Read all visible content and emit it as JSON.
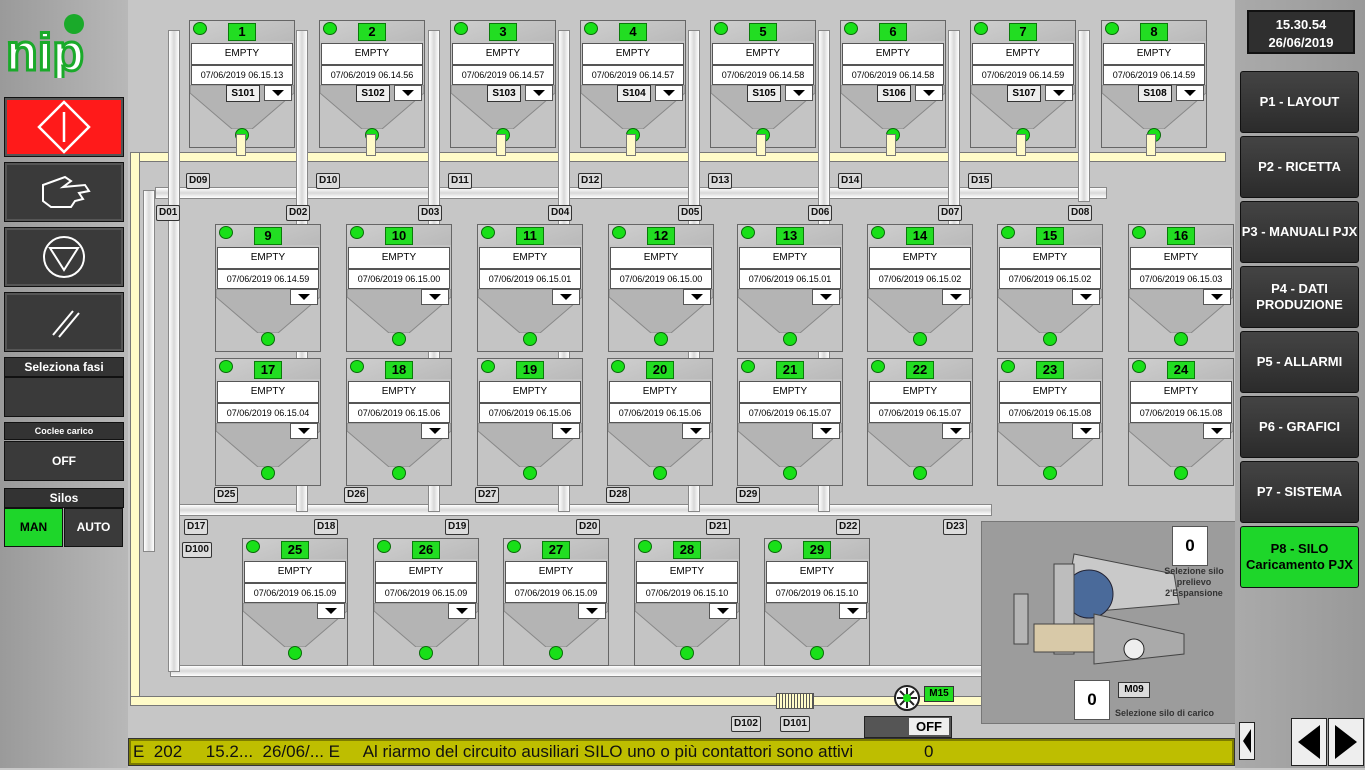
{
  "header": {
    "logo_text": "nip"
  },
  "clock": {
    "time": "15.30.54",
    "date": "26/06/2019"
  },
  "left": {
    "seleziona_fasi_label": "Seleziona fasi",
    "coclee_label": "Coclee carico",
    "coclee_value": "OFF",
    "silos_label": "Silos",
    "man_label": "MAN",
    "auto_label": "AUTO"
  },
  "nav": [
    {
      "label": "P1 - LAYOUT"
    },
    {
      "label": "P2 - RICETTA"
    },
    {
      "label": "P3 - MANUALI PJX"
    },
    {
      "label": "P4 - DATI PRODUZIONE"
    },
    {
      "label": "P5 - ALLARMI"
    },
    {
      "label": "P6 - GRAFICI"
    },
    {
      "label": "P7 - SISTEMA"
    },
    {
      "label": "P8 - SILO Caricamento PJX"
    }
  ],
  "silos": [
    {
      "num": "1",
      "state": "EMPTY",
      "date": "07/06/2019 06.15.13",
      "sid": "S101"
    },
    {
      "num": "2",
      "state": "EMPTY",
      "date": "07/06/2019 06.14.56",
      "sid": "S102"
    },
    {
      "num": "3",
      "state": "EMPTY",
      "date": "07/06/2019 06.14.57",
      "sid": "S103"
    },
    {
      "num": "4",
      "state": "EMPTY",
      "date": "07/06/2019 06.14.57",
      "sid": "S104"
    },
    {
      "num": "5",
      "state": "EMPTY",
      "date": "07/06/2019 06.14.58",
      "sid": "S105"
    },
    {
      "num": "6",
      "state": "EMPTY",
      "date": "07/06/2019 06.14.58",
      "sid": "S106"
    },
    {
      "num": "7",
      "state": "EMPTY",
      "date": "07/06/2019 06.14.59",
      "sid": "S107"
    },
    {
      "num": "8",
      "state": "EMPTY",
      "date": "07/06/2019 06.14.59",
      "sid": "S108"
    },
    {
      "num": "9",
      "state": "EMPTY",
      "date": "07/06/2019 06.14.59"
    },
    {
      "num": "10",
      "state": "EMPTY",
      "date": "07/06/2019 06.15.00"
    },
    {
      "num": "11",
      "state": "EMPTY",
      "date": "07/06/2019 06.15.01"
    },
    {
      "num": "12",
      "state": "EMPTY",
      "date": "07/06/2019 06.15.00"
    },
    {
      "num": "13",
      "state": "EMPTY",
      "date": "07/06/2019 06.15.01"
    },
    {
      "num": "14",
      "state": "EMPTY",
      "date": "07/06/2019 06.15.02"
    },
    {
      "num": "15",
      "state": "EMPTY",
      "date": "07/06/2019 06.15.02"
    },
    {
      "num": "16",
      "state": "EMPTY",
      "date": "07/06/2019 06.15.03"
    },
    {
      "num": "17",
      "state": "EMPTY",
      "date": "07/06/2019 06.15.04"
    },
    {
      "num": "18",
      "state": "EMPTY",
      "date": "07/06/2019 06.15.06"
    },
    {
      "num": "19",
      "state": "EMPTY",
      "date": "07/06/2019 06.15.06"
    },
    {
      "num": "20",
      "state": "EMPTY",
      "date": "07/06/2019 06.15.06"
    },
    {
      "num": "21",
      "state": "EMPTY",
      "date": "07/06/2019 06.15.07"
    },
    {
      "num": "22",
      "state": "EMPTY",
      "date": "07/06/2019 06.15.07"
    },
    {
      "num": "23",
      "state": "EMPTY",
      "date": "07/06/2019 06.15.08"
    },
    {
      "num": "24",
      "state": "EMPTY",
      "date": "07/06/2019 06.15.08"
    },
    {
      "num": "25",
      "state": "EMPTY",
      "date": "07/06/2019 06.15.09"
    },
    {
      "num": "26",
      "state": "EMPTY",
      "date": "07/06/2019 06.15.09"
    },
    {
      "num": "27",
      "state": "EMPTY",
      "date": "07/06/2019 06.15.09"
    },
    {
      "num": "28",
      "state": "EMPTY",
      "date": "07/06/2019 06.15.10"
    },
    {
      "num": "29",
      "state": "EMPTY",
      "date": "07/06/2019 06.15.10"
    }
  ],
  "diverters": [
    "D01",
    "D02",
    "D03",
    "D04",
    "D05",
    "D06",
    "D07",
    "D08",
    "D09",
    "D10",
    "D11",
    "D12",
    "D13",
    "D14",
    "D15",
    "D17",
    "D18",
    "D19",
    "D20",
    "D21",
    "D22",
    "D23",
    "D25",
    "D26",
    "D27",
    "D28",
    "D29",
    "D100",
    "D101",
    "D102"
  ],
  "expansion": {
    "value_top": "0",
    "label_top": "Selezione silo prelievo 2'Espansione",
    "value_bottom": "0",
    "label_bottom": "Selezione silo di carico",
    "motor": "M09"
  },
  "fan": {
    "motor": "M15",
    "switch": "OFF"
  },
  "status": {
    "code": "E  202",
    "time": "15.2...",
    "date": "26/06/...",
    "type": "E",
    "message": "Al riarmo del circuito ausiliari SILO uno o più contattori sono attivi",
    "count": "0"
  },
  "colors": {
    "accent_green": "#1ed62a",
    "alarm_red": "#ff1a1a",
    "status_yellow": "#bebe00"
  }
}
